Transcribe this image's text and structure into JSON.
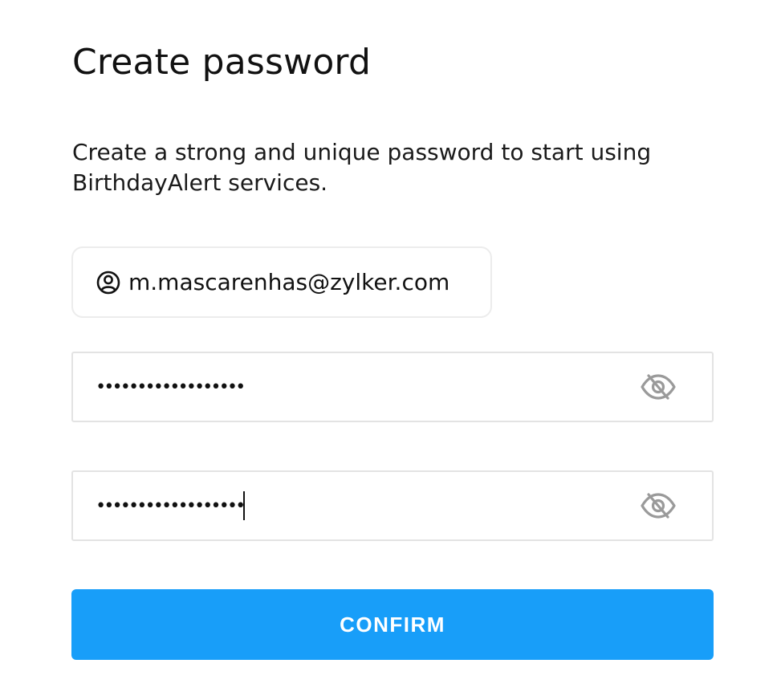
{
  "page": {
    "title": "Create password",
    "description": "Create a strong and unique password to start using BirthdayAlert services."
  },
  "account": {
    "email": "m.mascarenhas@zylker.com",
    "icon": "user-circle-icon"
  },
  "fields": {
    "password": {
      "masked_value": "••••••••••••••••••",
      "toggle_icon": "eye-slash-icon"
    },
    "confirm_password": {
      "masked_value": "••••••••••••••••••",
      "toggle_icon": "eye-slash-icon"
    }
  },
  "actions": {
    "confirm_label": "CONFIRM"
  },
  "colors": {
    "primary": "#189ef9",
    "icon_muted": "#9a9a9a",
    "border": "#e3e3e3"
  }
}
